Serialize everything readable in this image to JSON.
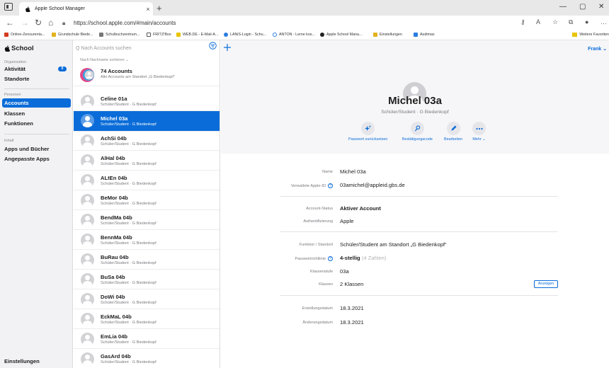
{
  "browser": {
    "tab_title": "Apple School Manager",
    "tab_close": "×",
    "new_tab": "+",
    "url": "https://school.apple.com/#main/accounts",
    "bookmarks": [
      "Online-Zensurenta...",
      "Grundschule Biede...",
      "Schulbuchzentrum...",
      "FRITZ!Box",
      "WEB.DE - E-Mail-A...",
      "LANiS-Login - Schu...",
      "ANTON - Lerne kos...",
      "Apple School Mana...",
      "Einstellungen",
      "Audimax"
    ],
    "favorites_label": "Weitere Favoriten",
    "window_controls": [
      "—",
      "▢",
      "✕"
    ]
  },
  "colors": {
    "accent": "#0a6cd8",
    "sidebar_bg": "#f2f2f4"
  },
  "sidebar": {
    "logo": "School",
    "sections": [
      {
        "label": "Organisation"
      },
      {
        "label": "Personen"
      },
      {
        "label": "Inhalt"
      }
    ],
    "items": [
      {
        "label": "Aktivität",
        "badge": "0"
      },
      {
        "label": "Standorte"
      },
      {
        "label": "Accounts",
        "active": true
      },
      {
        "label": "Klassen"
      },
      {
        "label": "Funktionen"
      },
      {
        "label": "Apps und Bücher"
      },
      {
        "label": "Angepasste Apps"
      }
    ],
    "footer": "Einstellungen"
  },
  "list": {
    "search_placeholder": "Q Nach Accounts suchen",
    "sort_label": "Nach Nachname sortieren ⌄",
    "all_accounts": {
      "name": "74 Accounts",
      "sub": "Alle Accounts am Standort „G Biedenkopf“"
    },
    "rows": [
      {
        "name": "Celine 01a",
        "sub": "Schüler/Student · G Biedenkopf"
      },
      {
        "name": "Michel 03a",
        "sub": "Schüler/Student · G Biedenkopf",
        "selected": true
      },
      {
        "name": "AchSi 04b",
        "sub": "Schüler/Student · G Biedenkopf"
      },
      {
        "name": "AlHal 04b",
        "sub": "Schüler/Student · G Biedenkopf"
      },
      {
        "name": "ALtEn 04b",
        "sub": "Schüler/Student · G Biedenkopf"
      },
      {
        "name": "BeMor 04b",
        "sub": "Schüler/Student · G Biedenkopf"
      },
      {
        "name": "BendMa 04b",
        "sub": "Schüler/Student · G Biedenkopf"
      },
      {
        "name": "BennMa 04b",
        "sub": "Schüler/Student · G Biedenkopf"
      },
      {
        "name": "BuRau 04b",
        "sub": "Schüler/Student · G Biedenkopf"
      },
      {
        "name": "BuSa 04b",
        "sub": "Schüler/Student · G Biedenkopf"
      },
      {
        "name": "DoWi 04b",
        "sub": "Schüler/Student · G Biedenkopf"
      },
      {
        "name": "EckMaL 04b",
        "sub": "Schüler/Student · G Biedenkopf"
      },
      {
        "name": "EmLia 04b",
        "sub": "Schüler/Student · G Biedenkopf"
      },
      {
        "name": "GasArd 04b",
        "sub": "Schüler/Student · G Biedenkopf"
      }
    ]
  },
  "detail": {
    "user_menu": "Frank ⌄",
    "name": "Michel 03a",
    "role": "Schüler/Student · G Biedenkopf",
    "actions": [
      {
        "label": "Passwort zurücksetzen",
        "icon": "sparkle-icon"
      },
      {
        "label": "Bestätigungscode",
        "icon": "key-icon"
      },
      {
        "label": "Bearbeiten",
        "icon": "pencil-icon"
      },
      {
        "label": "Mehr ⌄",
        "icon": "more-icon"
      }
    ],
    "fields": {
      "name_label": "Name",
      "name_value": "Michel 03a",
      "appleid_label": "Verwaltete Apple-ID",
      "appleid_value": "03amichel@appleid.gbs.de",
      "status_label": "Account-Status",
      "status_value": "Aktiver Account",
      "auth_label": "Authentifizierung",
      "auth_value": "Apple",
      "role_label": "Funktion / Standort",
      "role_value": "Schüler/Student am Standort „G Biedenkopf“",
      "pwpolicy_label": "Passwortrichtlinie",
      "pwpolicy_value": "4-stellig",
      "pwpolicy_hint": "(4 Zahlen)",
      "grade_label": "Klassenstufe",
      "grade_value": "03a",
      "classes_label": "Klassen",
      "classes_value": "2 Klassen",
      "classes_button": "Anzeigen",
      "created_label": "Erstellungsdatum",
      "created_value": "18.3.2021",
      "modified_label": "Änderungsdatum",
      "modified_value": "18.3.2021"
    }
  }
}
